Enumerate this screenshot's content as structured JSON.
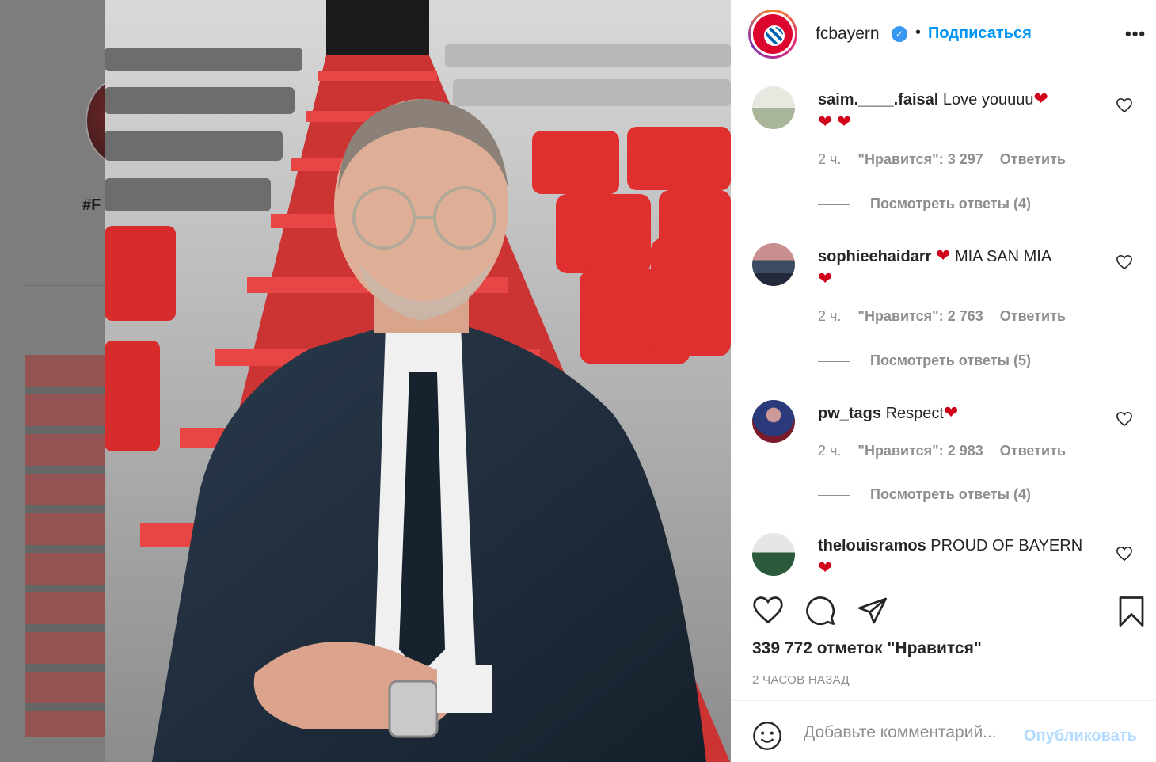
{
  "background": {
    "hashtag_fragment": "#F"
  },
  "post": {
    "author": "fcbayern",
    "follow_label": "Подписаться",
    "dot": "•",
    "more_label": "•••",
    "verified_mark": "✓"
  },
  "comments": [
    {
      "user": "saim.____.faisal",
      "text": "Love youuuu",
      "trailing_hearts": 2,
      "time": "2 ч.",
      "likes": "\"Нравится\": 3 297",
      "reply": "Ответить",
      "view_replies": "Посмотреть ответы (4)"
    },
    {
      "user": "sophieehaidarr",
      "text": "MIA SAN MIA",
      "trailing_hearts": 1,
      "time": "2 ч.",
      "likes": "\"Нравится\": 2 763",
      "reply": "Ответить",
      "view_replies": "Посмотреть ответы (5)"
    },
    {
      "user": "pw_tags",
      "text": "Respect",
      "trailing_hearts": 0,
      "time": "2 ч.",
      "likes": "\"Нравится\": 2 983",
      "reply": "Ответить",
      "view_replies": "Посмотреть ответы (4)"
    },
    {
      "user": "thelouisramos",
      "text": "PROUD OF BAYERN",
      "trailing_hearts": 0
    }
  ],
  "actions": {
    "like_count": "339 772 отметок \"Нравится\"",
    "time_ago": "2 ЧАСОВ НАЗАД"
  },
  "add_comment": {
    "placeholder": "Добавьте комментарий...",
    "publish_label": "Опубликовать"
  },
  "colors": {
    "link_blue": "#0095f6",
    "publish_disabled": "#b3dbff",
    "heart_red": "#d0021b",
    "meta_gray": "#8e8e8e"
  },
  "icons": [
    "heart-icon",
    "comment-icon",
    "share-icon",
    "bookmark-icon",
    "smile-icon",
    "like-comment-icon",
    "verified-icon",
    "more-icon"
  ]
}
